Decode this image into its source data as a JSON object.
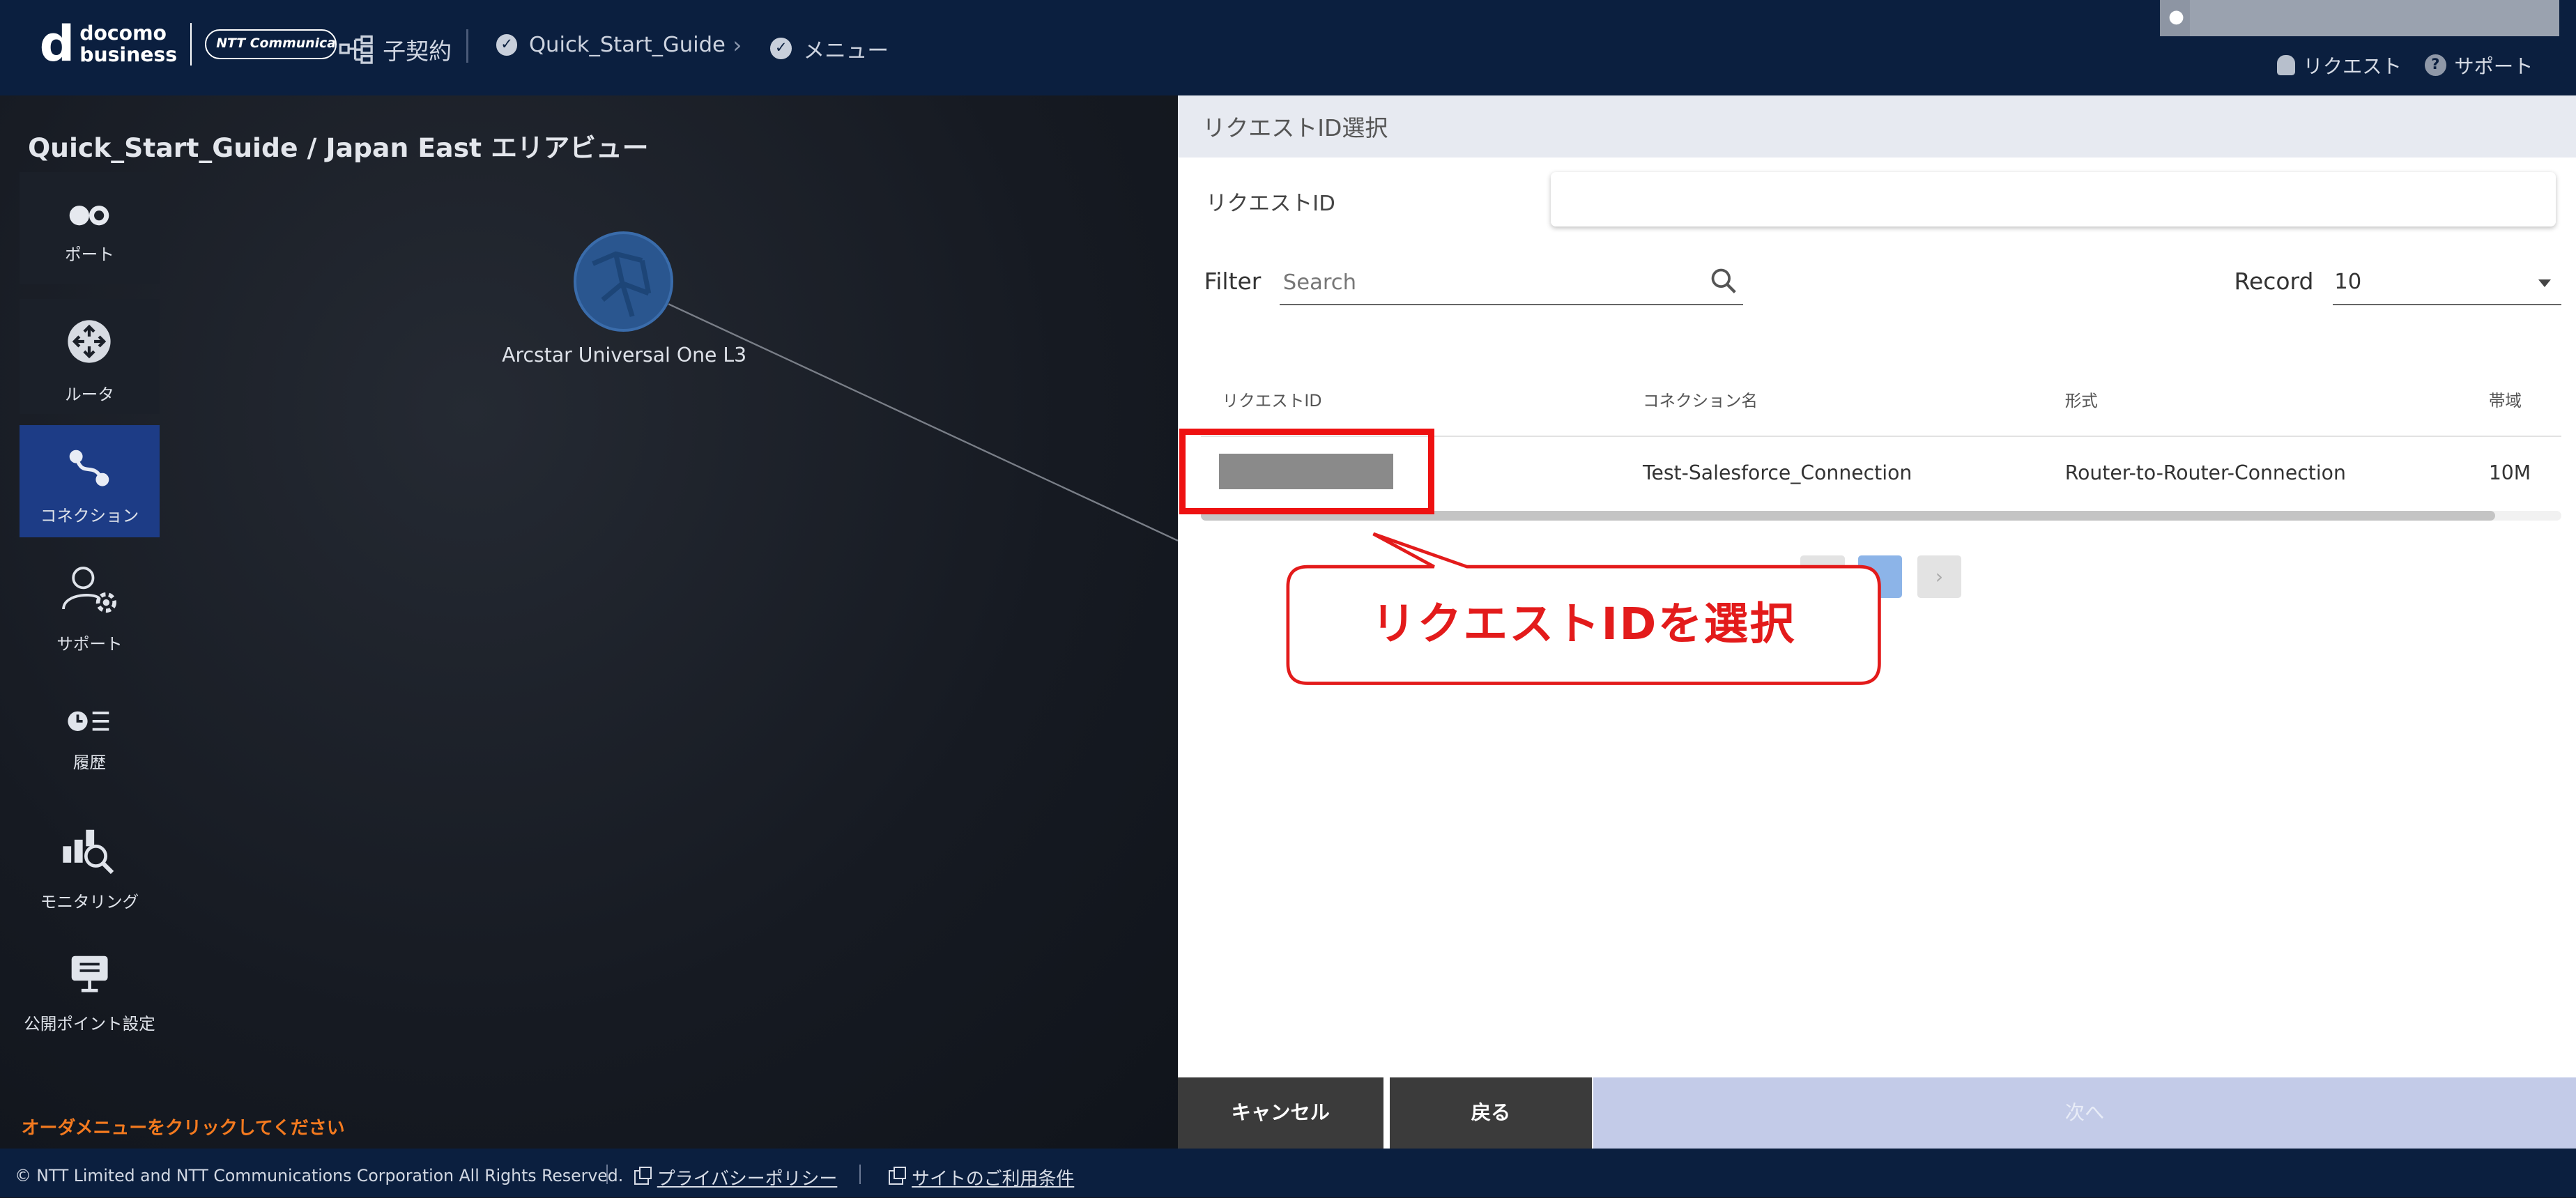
{
  "header": {
    "logo_top": "docomo",
    "logo_bottom": "business",
    "ntt_logo": "NTT Communications",
    "contract": "子契約",
    "crumb1": "Quick_Start_Guide",
    "crumb2": "メニュー",
    "request_link": "リクエスト",
    "support_link": "サポート"
  },
  "canvas": {
    "title": "Quick_Start_Guide / Japan East エリアビュー",
    "node_label": "Arcstar Universal One L3",
    "order_message": "オーダメニューをクリックしてください"
  },
  "sidebar": {
    "items": [
      {
        "label": "ポート",
        "icon": "port-icon"
      },
      {
        "label": "ルータ",
        "icon": "router-icon"
      },
      {
        "label": "コネクション",
        "icon": "connection-icon"
      },
      {
        "label": "サポート",
        "icon": "support-user-gear-icon"
      },
      {
        "label": "履歴",
        "icon": "history-icon"
      },
      {
        "label": "モニタリング",
        "icon": "monitoring-icon"
      },
      {
        "label": "公開ポイント設定",
        "icon": "public-point-icon"
      }
    ]
  },
  "panel": {
    "title": "リクエストID選択",
    "request_id_label": "リクエストID",
    "request_id_value": "",
    "filter_label": "Filter",
    "search_placeholder": "Search",
    "record_label": "Record",
    "record_value": "10",
    "table": {
      "headers": [
        "リクエストID",
        "コネクション名",
        "形式",
        "帯域"
      ],
      "rows": [
        {
          "request_id": "",
          "connection_name": "Test-Salesforce_Connection",
          "type": "Router-to-Router-Connection",
          "bandwidth": "10M"
        }
      ]
    },
    "pagination": {
      "current": "1",
      "next": "›"
    },
    "buttons": {
      "cancel": "キャンセル",
      "back": "戻る",
      "next": "次へ"
    }
  },
  "annotation": {
    "callout": "リクエストIDを選択",
    "color": "#e31b1b"
  },
  "footer": {
    "copyright": "© NTT Limited and NTT Communications Corporation All Rights Reserved.",
    "privacy": "プライバシーポリシー",
    "terms": "サイトのご利用条件"
  }
}
